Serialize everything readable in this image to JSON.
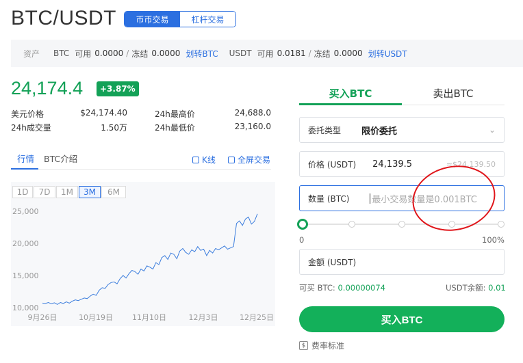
{
  "header": {
    "pair": "BTC/USDT",
    "modes": [
      "币币交易",
      "杠杆交易"
    ],
    "active_mode": "币币交易"
  },
  "assets": {
    "label": "资产",
    "btc_name": "BTC",
    "btc_available_label": "可用",
    "btc_available": "0.0000",
    "btc_frozen_label": "冻结",
    "btc_frozen": "0.0000",
    "btc_transfer": "划转BTC",
    "usdt_name": "USDT",
    "usdt_available_label": "可用",
    "usdt_available": "0.0181",
    "usdt_frozen_label": "冻结",
    "usdt_frozen": "0.0000",
    "usdt_transfer": "划转USDT"
  },
  "ticker": {
    "last_price": "24,174.4",
    "change": "+3.87%",
    "usd_price_label": "美元价格",
    "usd_price": "$24,174.40",
    "high_label": "24h最高价",
    "high": "24,688.0",
    "volume_label": "24h成交量",
    "volume": "1.50万",
    "low_label": "24h最低价",
    "low": "23,160.0"
  },
  "info_tabs": {
    "market": "行情",
    "intro": "BTC介绍",
    "kline": "K线",
    "fullscreen": "全屏交易"
  },
  "ranges": [
    "1D",
    "7D",
    "1M",
    "3M",
    "6M"
  ],
  "active_range": "3M",
  "chart_data": {
    "type": "line",
    "x_tick_labels": [
      "9月26日",
      "10月19日",
      "11月10日",
      "12月3日",
      "12月25日"
    ],
    "y_tick_labels": [
      "25,000",
      "20,000",
      "15,000",
      "10,000"
    ],
    "ylim": [
      10000,
      25000
    ],
    "series": [
      {
        "color": "#3b7ddd",
        "values": [
          10700,
          10650,
          10800,
          10600,
          10750,
          10500,
          10800,
          10650,
          10900,
          10700,
          11000,
          11200,
          11100,
          11300,
          11500,
          11400,
          11800,
          12100,
          11900,
          12700,
          13100,
          13000,
          13600,
          13900,
          14000,
          13700,
          14500,
          15000,
          14600,
          15300,
          15800,
          15600,
          15200,
          16000,
          15700,
          16500,
          16300,
          16000,
          17000,
          16700,
          17800,
          18100,
          17500,
          18500,
          18300,
          17600,
          18800,
          19200,
          18600,
          18300,
          19000,
          18700,
          19500,
          18900,
          19100,
          18100,
          18900,
          18500,
          19200,
          19000,
          19300,
          19600,
          19100,
          19300,
          19500,
          23100,
          23500,
          22800,
          23800,
          24100,
          23000,
          23400,
          24600
        ]
      }
    ]
  },
  "order": {
    "buy_tab": "买入BTC",
    "sell_tab": "卖出BTC",
    "type_label": "委托类型",
    "type_value": "限价委托",
    "price_label": "价格 (USDT)",
    "price_value": "24,139.5",
    "price_usd": "≈$24,139.50",
    "amount_label": "数量 (BTC)",
    "amount_placeholder": "最小交易数量是0.001BTC",
    "slider_min": "0",
    "slider_max": "100%",
    "slider_value": 0,
    "total_label": "金额 (USDT)",
    "can_buy_label": "可买 BTC:",
    "can_buy_value": "0.00000074",
    "balance_label": "USDT余额:",
    "balance_value": "0.01",
    "submit": "买入BTC",
    "fee_link": "费率标准"
  },
  "colors": {
    "accent": "#2b6fe0",
    "buy": "#13a157",
    "annotation": "#e0161b"
  }
}
